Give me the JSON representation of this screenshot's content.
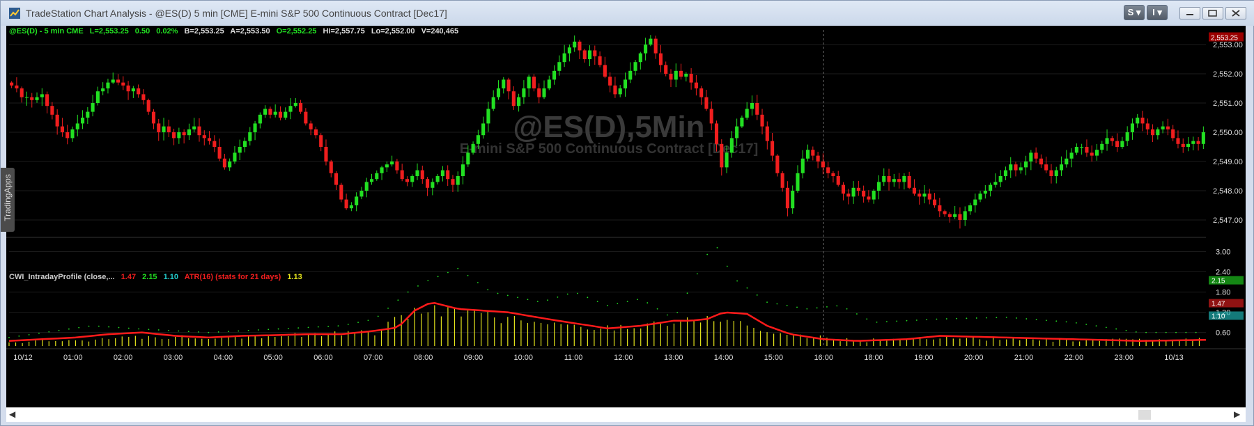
{
  "window": {
    "title": "TradeStation Chart Analysis - @ES(D) 5 min [CME] E-mini S&P 500 Continuous Contract [Dec17]",
    "btn_s": "S",
    "btn_i": "I",
    "side_tab": "TradingApps"
  },
  "status": {
    "symbol": "@ES(D) - 5 min  CME",
    "last": "L=2,553.25",
    "chg": "0.50",
    "pct": "0.02%",
    "bid": "B=2,553.25",
    "ask": "A=2,553.50",
    "open": "O=2,552.25",
    "high": "Hi=2,557.75",
    "low": "Lo=2,552.00",
    "vol": "V=240,465"
  },
  "indicator": {
    "name": "CWI_IntradayProfile (close,...",
    "v1": "1.47",
    "v2": "2.15",
    "v3": "1.10",
    "atr": "ATR(16) (stats for 21 days)",
    "v4": "1.13"
  },
  "watermark": {
    "symbol": "@ES(D),5Min",
    "desc": "E-mini S&P 500 Continuous Contract [Dec17]"
  },
  "colors": {
    "up": "#22e022",
    "down": "#f01e1e",
    "atr": "#ff1a1a",
    "histo": "#e5e51c",
    "cyan": "#22cccc",
    "bg": "#000000"
  },
  "chart_data": [
    {
      "type": "candlestick",
      "title": "@ES(D),5Min",
      "ylim": [
        2546.5,
        2553.5
      ],
      "yticks": [
        2547.0,
        2548.0,
        2549.0,
        2550.0,
        2551.0,
        2552.0,
        2553.0
      ],
      "ytick_labels": [
        "2,547.00",
        "2,548.00",
        "2,549.00",
        "2,550.00",
        "2,551.00",
        "2,552.00",
        "2,553.00"
      ],
      "last_price_label": "2,553.25",
      "x_labels": [
        "10/12",
        "01:00",
        "02:00",
        "03:00",
        "04:00",
        "05:00",
        "06:00",
        "07:00",
        "08:00",
        "09:00",
        "10:00",
        "11:00",
        "12:00",
        "13:00",
        "14:00",
        "15:00",
        "16:00",
        "18:00",
        "19:00",
        "20:00",
        "21:00",
        "22:00",
        "23:00",
        "10/13"
      ],
      "session_marker": "16:00",
      "closes": [
        2551.6,
        2551.5,
        2551.2,
        2551.2,
        2551.1,
        2551.2,
        2551.3,
        2550.9,
        2550.6,
        2550.2,
        2550.0,
        2549.8,
        2550.1,
        2550.3,
        2550.5,
        2550.7,
        2551.0,
        2551.4,
        2551.5,
        2551.7,
        2551.8,
        2551.7,
        2551.6,
        2551.4,
        2551.5,
        2551.3,
        2551.1,
        2550.7,
        2550.3,
        2550.0,
        2550.2,
        2550.0,
        2549.8,
        2550.0,
        2549.9,
        2550.1,
        2550.2,
        2549.9,
        2549.8,
        2549.7,
        2549.5,
        2549.1,
        2548.8,
        2549.0,
        2549.3,
        2549.5,
        2549.7,
        2550.0,
        2550.3,
        2550.6,
        2550.8,
        2550.6,
        2550.7,
        2550.5,
        2550.7,
        2550.9,
        2551.0,
        2550.7,
        2550.3,
        2550.1,
        2549.9,
        2549.5,
        2549.0,
        2548.6,
        2548.2,
        2547.7,
        2547.4,
        2547.5,
        2547.8,
        2548.0,
        2548.3,
        2548.4,
        2548.6,
        2548.8,
        2548.9,
        2549.0,
        2548.7,
        2548.4,
        2548.3,
        2548.5,
        2548.7,
        2548.4,
        2548.1,
        2548.3,
        2548.5,
        2548.7,
        2548.4,
        2548.2,
        2548.5,
        2548.9,
        2549.3,
        2549.6,
        2549.9,
        2550.3,
        2550.8,
        2551.2,
        2551.5,
        2551.8,
        2551.4,
        2550.9,
        2551.2,
        2551.5,
        2551.9,
        2551.5,
        2551.2,
        2551.5,
        2551.8,
        2552.1,
        2552.4,
        2552.7,
        2552.9,
        2553.1,
        2552.8,
        2552.5,
        2552.8,
        2552.6,
        2552.3,
        2551.9,
        2551.6,
        2551.3,
        2551.5,
        2551.8,
        2552.1,
        2552.4,
        2552.7,
        2553.0,
        2553.2,
        2552.7,
        2552.3,
        2552.0,
        2551.8,
        2552.1,
        2551.9,
        2552.0,
        2551.7,
        2551.5,
        2551.2,
        2550.8,
        2550.3,
        2549.6,
        2548.8,
        2549.3,
        2549.8,
        2550.2,
        2550.5,
        2550.8,
        2551.0,
        2550.6,
        2550.2,
        2549.7,
        2549.2,
        2548.6,
        2548.1,
        2547.4,
        2548.0,
        2548.6,
        2549.1,
        2549.4,
        2549.2,
        2549.0,
        2548.8,
        2548.6,
        2548.5,
        2548.2,
        2547.9,
        2547.8,
        2548.1,
        2548.0,
        2547.8,
        2547.7,
        2548.0,
        2548.3,
        2548.5,
        2548.3,
        2548.4,
        2548.3,
        2548.5,
        2548.1,
        2547.9,
        2547.8,
        2547.9,
        2547.7,
        2547.5,
        2547.3,
        2547.2,
        2547.1,
        2547.2,
        2547.0,
        2547.3,
        2547.5,
        2547.7,
        2547.9,
        2548.0,
        2548.2,
        2548.3,
        2548.5,
        2548.7,
        2548.9,
        2548.7,
        2548.8,
        2549.0,
        2549.3,
        2549.1,
        2548.9,
        2548.7,
        2548.5,
        2548.7,
        2548.9,
        2549.1,
        2549.3,
        2549.5,
        2549.5,
        2549.3,
        2549.2,
        2549.4,
        2549.6,
        2549.8,
        2549.7,
        2549.5,
        2549.7,
        2550.0,
        2550.3,
        2550.5,
        2550.3,
        2550.1,
        2549.9,
        2550.1,
        2550.2,
        2550.1,
        2549.8,
        2549.6,
        2549.5,
        2549.6,
        2549.7,
        2549.6,
        2550.0
      ]
    },
    {
      "type": "line",
      "title": "CWI_IntradayProfile",
      "ylim": [
        0.2,
        3.3
      ],
      "yticks": [
        0.6,
        1.2,
        1.8,
        2.4,
        3.0
      ],
      "ytick_labels": [
        "0.60",
        "1.20",
        "1.80",
        "2.40",
        "3.00"
      ],
      "right_labels": [
        {
          "value": 2.15,
          "label": "2.15",
          "color": "#22e022"
        },
        {
          "value": 1.47,
          "label": "1.47",
          "color": "#f01e1e"
        },
        {
          "value": 1.1,
          "label": "1.10",
          "color": "#22cccc"
        }
      ],
      "series": [
        {
          "name": "ATR(16) (stats for 21 days)",
          "color": "#ff1a1a",
          "profile": [
            [
              0,
              0.35
            ],
            [
              20,
              0.45
            ],
            [
              30,
              0.55
            ],
            [
              40,
              0.6
            ],
            [
              50,
              0.5
            ],
            [
              60,
              0.45
            ],
            [
              70,
              0.5
            ],
            [
              80,
              0.52
            ],
            [
              90,
              0.55
            ],
            [
              100,
              0.55
            ],
            [
              110,
              0.65
            ],
            [
              117,
              0.75
            ],
            [
              122,
              1.25
            ],
            [
              127,
              1.5
            ],
            [
              135,
              1.3
            ],
            [
              150,
              1.2
            ],
            [
              165,
              0.95
            ],
            [
              175,
              0.8
            ],
            [
              180,
              0.72
            ],
            [
              190,
              0.8
            ],
            [
              200,
              0.95
            ],
            [
              205,
              0.95
            ],
            [
              210,
              1.0
            ],
            [
              215,
              1.2
            ],
            [
              222,
              1.15
            ],
            [
              228,
              0.8
            ],
            [
              235,
              0.55
            ],
            [
              245,
              0.4
            ],
            [
              255,
              0.35
            ],
            [
              270,
              0.4
            ],
            [
              280,
              0.5
            ],
            [
              300,
              0.45
            ],
            [
              320,
              0.4
            ],
            [
              340,
              0.35
            ],
            [
              360,
              0.38
            ]
          ]
        },
        {
          "name": "green",
          "color": "#22e022",
          "profile": [
            [
              0,
              0.45
            ],
            [
              25,
              0.8
            ],
            [
              40,
              0.7
            ],
            [
              60,
              0.6
            ],
            [
              80,
              0.7
            ],
            [
              100,
              0.8
            ],
            [
              110,
              1.0
            ],
            [
              120,
              1.8
            ],
            [
              125,
              2.1
            ],
            [
              135,
              2.5
            ],
            [
              145,
              1.8
            ],
            [
              160,
              1.5
            ],
            [
              170,
              1.8
            ],
            [
              180,
              1.4
            ],
            [
              190,
              1.6
            ],
            [
              200,
              1.0
            ],
            [
              212,
              3.3
            ],
            [
              218,
              2.2
            ],
            [
              228,
              1.5
            ],
            [
              240,
              1.3
            ],
            [
              250,
              1.4
            ],
            [
              260,
              0.9
            ],
            [
              280,
              1.0
            ],
            [
              300,
              1.05
            ],
            [
              320,
              0.9
            ],
            [
              340,
              0.6
            ],
            [
              360,
              0.6
            ]
          ]
        },
        {
          "name": "histo",
          "color": "#e5e51c",
          "profile": [
            [
              0,
              0.3
            ],
            [
              40,
              0.45
            ],
            [
              80,
              0.5
            ],
            [
              110,
              0.6
            ],
            [
              122,
              1.25
            ],
            [
              127,
              1.3
            ],
            [
              150,
              1.0
            ],
            [
              175,
              0.7
            ],
            [
              200,
              0.9
            ],
            [
              215,
              1.05
            ],
            [
              228,
              0.6
            ],
            [
              255,
              0.35
            ],
            [
              280,
              0.45
            ],
            [
              320,
              0.35
            ],
            [
              360,
              0.4
            ]
          ]
        }
      ]
    }
  ]
}
